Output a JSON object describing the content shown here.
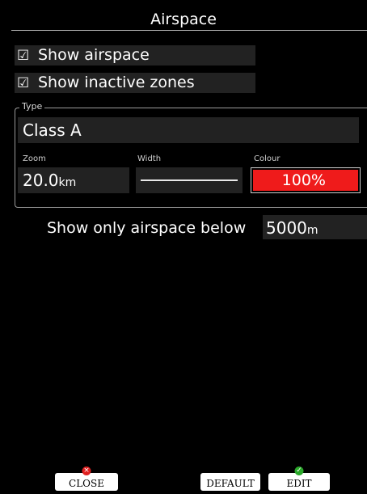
{
  "window": {
    "title": "Airspace"
  },
  "options": {
    "show_airspace": {
      "checkbox": "☑",
      "label": "Show airspace"
    },
    "show_inactive": {
      "checkbox": "☑",
      "label": "Show inactive zones"
    }
  },
  "type_group": {
    "legend": "Type",
    "value": "Class A",
    "zoom": {
      "label": "Zoom",
      "value": "20.0",
      "unit": "km"
    },
    "width": {
      "label": "Width"
    },
    "colour": {
      "label": "Colour",
      "value": "100%",
      "color": "#ef1b1b"
    }
  },
  "altitude": {
    "label": "Show only airspace below",
    "value": "5000",
    "unit": "m"
  },
  "buttons": {
    "close": {
      "label": "CLOSE",
      "status_icon": "red-x-icon",
      "status_glyph": "×"
    },
    "default": {
      "label": "DEFAULT"
    },
    "edit": {
      "label": "EDIT",
      "status_icon": "green-check-icon",
      "status_glyph": "✓"
    }
  }
}
